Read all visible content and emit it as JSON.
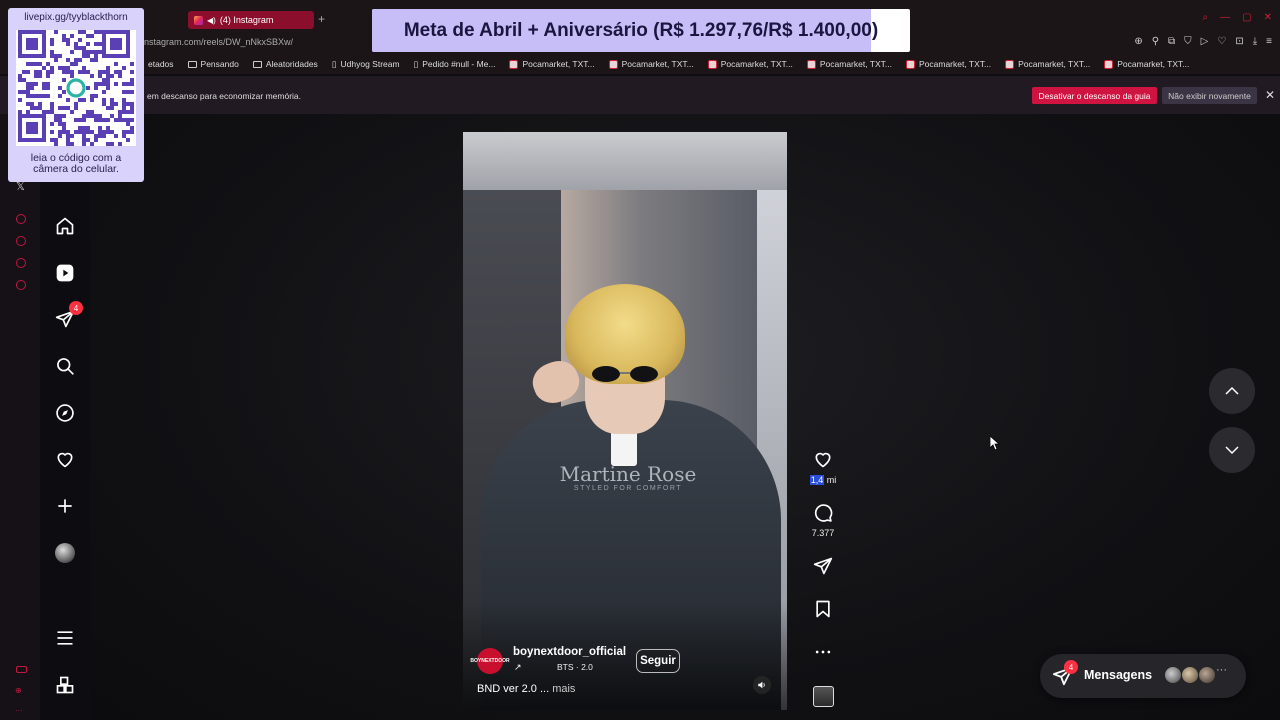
{
  "browser": {
    "tab_title": "(4) Instagram",
    "url": "nstagram.com/reels/DW_nNkxSBXw/",
    "bookmarks": [
      {
        "label": "etados",
        "type": "text"
      },
      {
        "label": "Pensando",
        "type": "folder"
      },
      {
        "label": "Aleatoridades",
        "type": "folder"
      },
      {
        "label": "Udhyog Stream",
        "type": "page"
      },
      {
        "label": "Pedido #null - Me...",
        "type": "page"
      },
      {
        "label": "Pocamarket, TXT...",
        "type": "fav"
      },
      {
        "label": "Pocamarket, TXT...",
        "type": "fav"
      },
      {
        "label": "Pocamarket, TXT...",
        "type": "fav"
      },
      {
        "label": "Pocamarket, TXT...",
        "type": "fav"
      },
      {
        "label": "Pocamarket, TXT...",
        "type": "fav"
      },
      {
        "label": "Pocamarket, TXT...",
        "type": "fav"
      },
      {
        "label": "Pocamarket, TXT...",
        "type": "fav"
      }
    ],
    "notice_text": "em descanso para economizar memória.",
    "notice_disable_label": "Desativar o descanso da guia",
    "notice_never_label": "Não exibir novamente"
  },
  "overlay": {
    "qr_title": "livepix.gg/tyyblackthorn",
    "qr_caption_line1": "leia o código com a",
    "qr_caption_line2": "câmera do celular.",
    "goal_text": "Meta de Abril + Aniversário (R$ 1.297,76/R$ 1.400,00)",
    "goal_progress": 0.927
  },
  "sidebar": {
    "messages_badge": "4"
  },
  "reel": {
    "shirt_brand": "Martine Rose",
    "shirt_tagline": "STYLED FOR COMFORT",
    "author": "boynextdoor_official",
    "author_avatar_text": "BOYNEXTDOOR",
    "audio": "BTS · 2.0",
    "follow_label": "Seguir",
    "caption": "BND ver 2.0 ...",
    "caption_more": "mais",
    "likes_highlight": "1,4",
    "likes_unit": " mi",
    "comments": "7.377"
  },
  "messages": {
    "label": "Mensagens",
    "badge": "4",
    "more": "···"
  },
  "colors": {
    "accent": "#c4163f",
    "notification": "#ff3040",
    "goal_fill": "#c7bef7"
  }
}
